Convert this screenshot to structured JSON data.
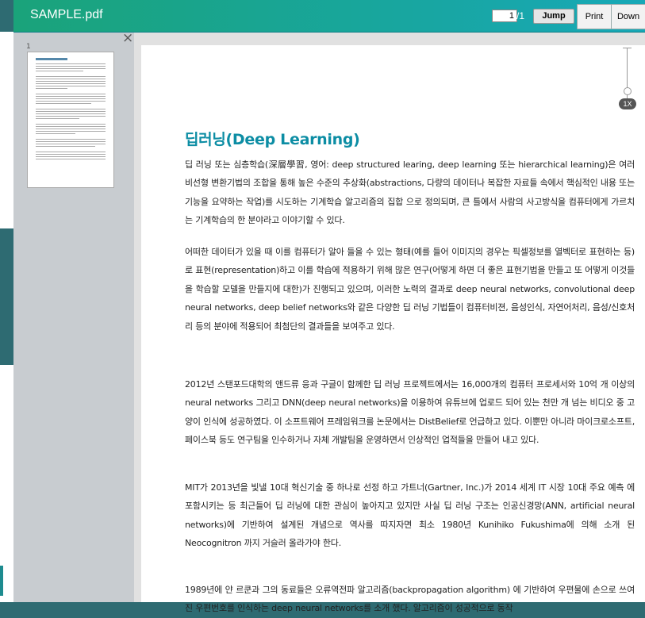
{
  "toolbar": {
    "title": "SAMPLE.pdf",
    "page_current": "1",
    "page_total": "/1",
    "jump_label": "Jump",
    "print_label": "Print",
    "download_label": "Down"
  },
  "sidebar": {
    "close_glyph": "×",
    "thumb_number": "1"
  },
  "zoom": {
    "badge": "1X"
  },
  "document": {
    "heading": "딥러닝(Deep Learning)",
    "paragraphs": [
      "딥 러닝 또는 심층학습(深層學習, 영어: deep structured learing, deep learning 또는 hierarchical learning)은 여러 비선형 변환기법의 조합을 통해 높은 수준의 추상화(abstractions, 다량의 데이터나 복잡한 자료들 속에서 핵심적인 내용 또는 기능을 요약하는 작업)를 시도하는 기계학습 알고리즘의 집합 으로 정의되며, 큰 틀에서 사람의 사고방식을 컴퓨터에게 가르치는 기계학습의 한 분야라고 이야기할 수 있다.",
      "어떠한 데이터가 있을 때 이를 컴퓨터가 알아 들을 수 있는 형태(예를 들어 이미지의 경우는 픽셀정보를 열벡터로 표현하는 등)로 표현(representation)하고 이를 학습에 적용하기 위해 많은 연구(어떻게 하면 더 좋은 표현기법을 만들고 또 어떻게 이것들을 학습할 모델을 만들지에 대한)가 진행되고 있으며, 이러한 노력의 결과로 deep neural networks, convolutional deep neural networks, deep belief networks와 같은 다양한 딥 러닝 기법들이 컴퓨터비젼, 음성인식, 자연어처리, 음성/신호처리 등의 분야에 적용되어 최첨단의 결과들을 보여주고 있다.",
      "2012년 스탠포드대학의 앤드류 응과 구글이 함께한 딥 러닝 프로젝트에서는 16,000개의 컴퓨터 프로세서와 10억 개 이상의 neural networks 그리고 DNN(deep neural networks)을 이용하여 유튜브에 업로드 되어 있는 천만 개 넘는 비디오 중 고양이 인식에 성공하였다. 이 소프트웨어 프레임워크를 논문에서는 DistBelief로 언급하고 있다. 이뿐만 아니라 마이크로소프트, 페이스북 등도 연구팀을 인수하거나 자체 개발팀을 운영하면서 인상적인 업적들을 만들어 내고 있다.",
      "MIT가 2013년을 빛낼 10대 혁신기술 중 하나로 선정 하고 가트너(Gartner, Inc.)가 2014 세계 IT 시장 10대 주요 예측 에 포함시키는 등 최근들어 딥 러닝에 대한 관심이 높아지고 있지만 사실 딥 러닝 구조는 인공신경망(ANN, artificial neural networks)에 기반하여 설계된 개념으로 역사를 따지자면 최소 1980년 Kunihiko Fukushima에 의해 소개 된 Neocognitron 까지 거슬러 올라가야 한다.",
      "1989년에 얀 르쿤과 그의 동료들은 오류역전파 알고리즘(backpropagation algorithm) 에 기반하여 우편물에 손으로 쓰여진 우편번호를 인식하는 deep neural networks를 소개 했다. 알고리즘이 성공적으로 동작"
    ]
  }
}
